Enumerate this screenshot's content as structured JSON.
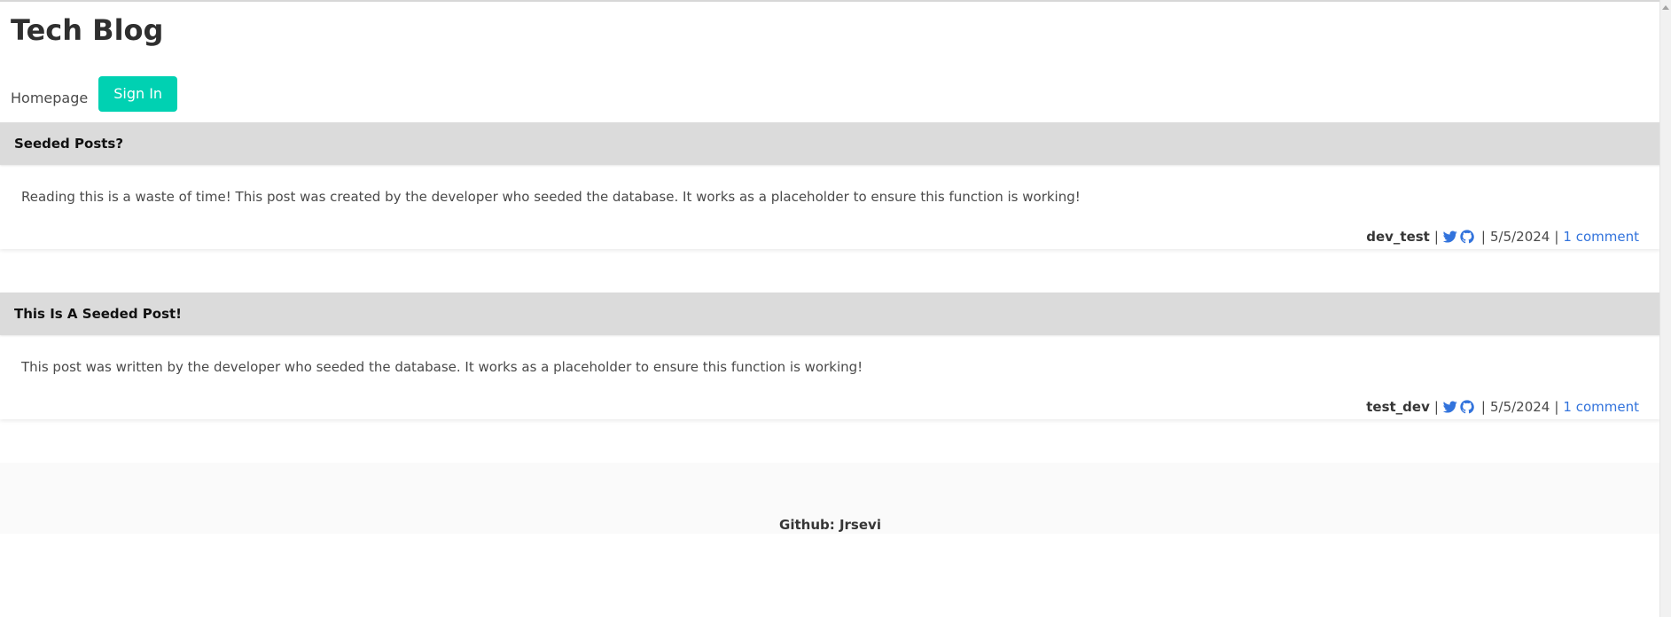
{
  "header": {
    "title": "Tech Blog"
  },
  "nav": {
    "home_label": "Homepage",
    "signin_label": "Sign In"
  },
  "posts": [
    {
      "title": "Seeded Posts?",
      "body": "Reading this is a waste of time! This post was created by the developer who seeded the database. It works as a placeholder to ensure this function is working!",
      "author": "dev_test",
      "date": "5/5/2024",
      "comments": "1 comment",
      "icons": [
        "twitter-icon",
        "github-icon"
      ]
    },
    {
      "title": "This Is A Seeded Post!",
      "body": "This post was written by the developer who seeded the database. It works as a placeholder to ensure this function is working!",
      "author": "test_dev",
      "date": "5/5/2024",
      "comments": "1 comment",
      "icons": [
        "twitter-icon",
        "github-icon"
      ]
    }
  ],
  "footer": {
    "text": "Github: Jrsevi"
  },
  "colors": {
    "accent": "#00d1b2",
    "link": "#3273dc",
    "post_header_bg": "#dbdbdb",
    "footer_bg": "#fafafa"
  }
}
